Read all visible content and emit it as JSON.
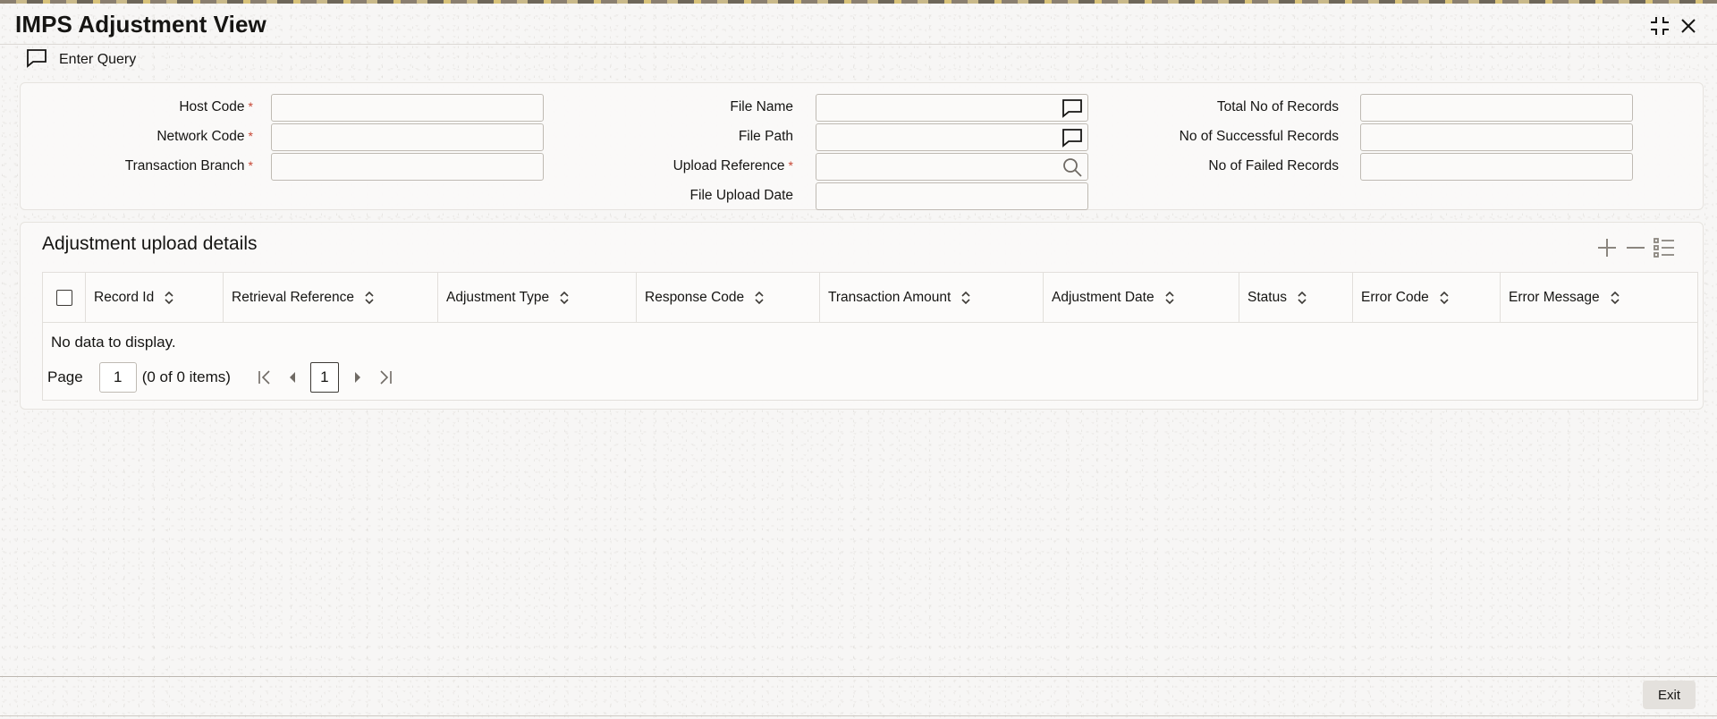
{
  "window": {
    "title": "IMPS Adjustment View"
  },
  "toolbar": {
    "enter_query_label": "Enter Query"
  },
  "form": {
    "host_code": {
      "label": "Host Code",
      "required": "*",
      "value": ""
    },
    "network_code": {
      "label": "Network Code",
      "required": "*",
      "value": ""
    },
    "transaction_branch": {
      "label": "Transaction Branch",
      "required": "*",
      "value": ""
    },
    "file_name": {
      "label": "File Name",
      "value": ""
    },
    "file_path": {
      "label": "File Path",
      "value": ""
    },
    "upload_reference": {
      "label": "Upload Reference",
      "required": "*",
      "value": ""
    },
    "file_upload_date": {
      "label": "File Upload Date",
      "value": ""
    },
    "total_records": {
      "label": "Total No of Records",
      "value": ""
    },
    "successful_records": {
      "label": "No of Successful Records",
      "value": ""
    },
    "failed_records": {
      "label": "No of Failed Records",
      "value": ""
    }
  },
  "grid": {
    "title": "Adjustment upload details",
    "columns": [
      "Record Id",
      "Retrieval Reference",
      "Adjustment Type",
      "Response Code",
      "Transaction Amount",
      "Adjustment Date",
      "Status",
      "Error Code",
      "Error Message"
    ],
    "empty_message": "No data to display.",
    "pager": {
      "page_label": "Page",
      "page_value": "1",
      "summary": "(0 of 0 items)",
      "current_page": "1"
    }
  },
  "footer": {
    "exit_label": "Exit"
  },
  "colors": {
    "required": "#c74634",
    "text": "#161513",
    "panel_border": "#e6e3df",
    "input_border": "#bfbab3"
  }
}
